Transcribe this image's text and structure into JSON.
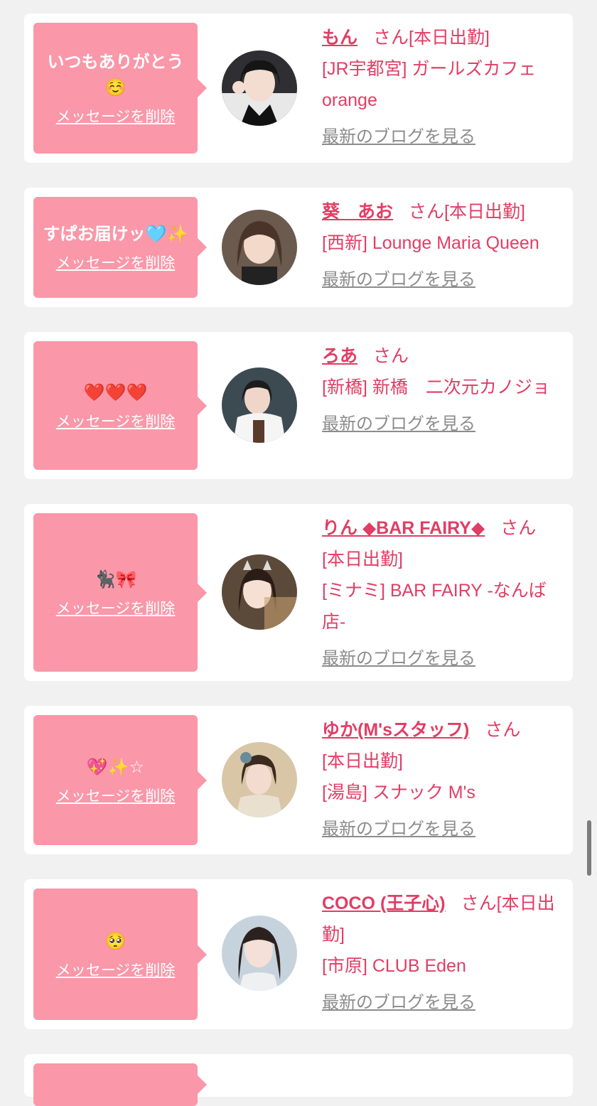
{
  "san_label": "さん",
  "delete_label": "メッセージを削除",
  "blog_label": "最新のブログを見る",
  "cards": [
    {
      "message": "いつもありがとう☺️",
      "name": "もん",
      "detail_inline": "[本日出勤]",
      "shop": "[JR宇都宮] ガールズカフェorange"
    },
    {
      "message": "すぱお届けッ🩵✨",
      "name": "葵　あお",
      "detail_inline": "[本日出勤]",
      "shop": "[西新] Lounge Maria Queen"
    },
    {
      "message": "❤️❤️❤️",
      "name": "ろあ",
      "detail_inline": "",
      "shop": "[新橋] 新橋　二次元カノジョ"
    },
    {
      "message": "🐈‍⬛🎀",
      "name": "りん ◆BAR FAIRY◆",
      "detail_inline": "[本日出勤]",
      "shop": "[ミナミ] BAR FAIRY -なんば店-"
    },
    {
      "message": "💖✨☆",
      "name": "ゆか(M'sスタッフ)",
      "detail_inline": "[本日出勤]",
      "shop": "[湯島] スナック M's"
    },
    {
      "message": "🥺",
      "name": "COCO (王子心)",
      "detail_inline": "[本日出勤]",
      "shop": "[市原] CLUB Eden"
    }
  ],
  "colors": {
    "bubble": "#fa97a9",
    "accent": "#e23d64",
    "link_gray": "#8c8c8c",
    "background": "#f1f1f1"
  }
}
